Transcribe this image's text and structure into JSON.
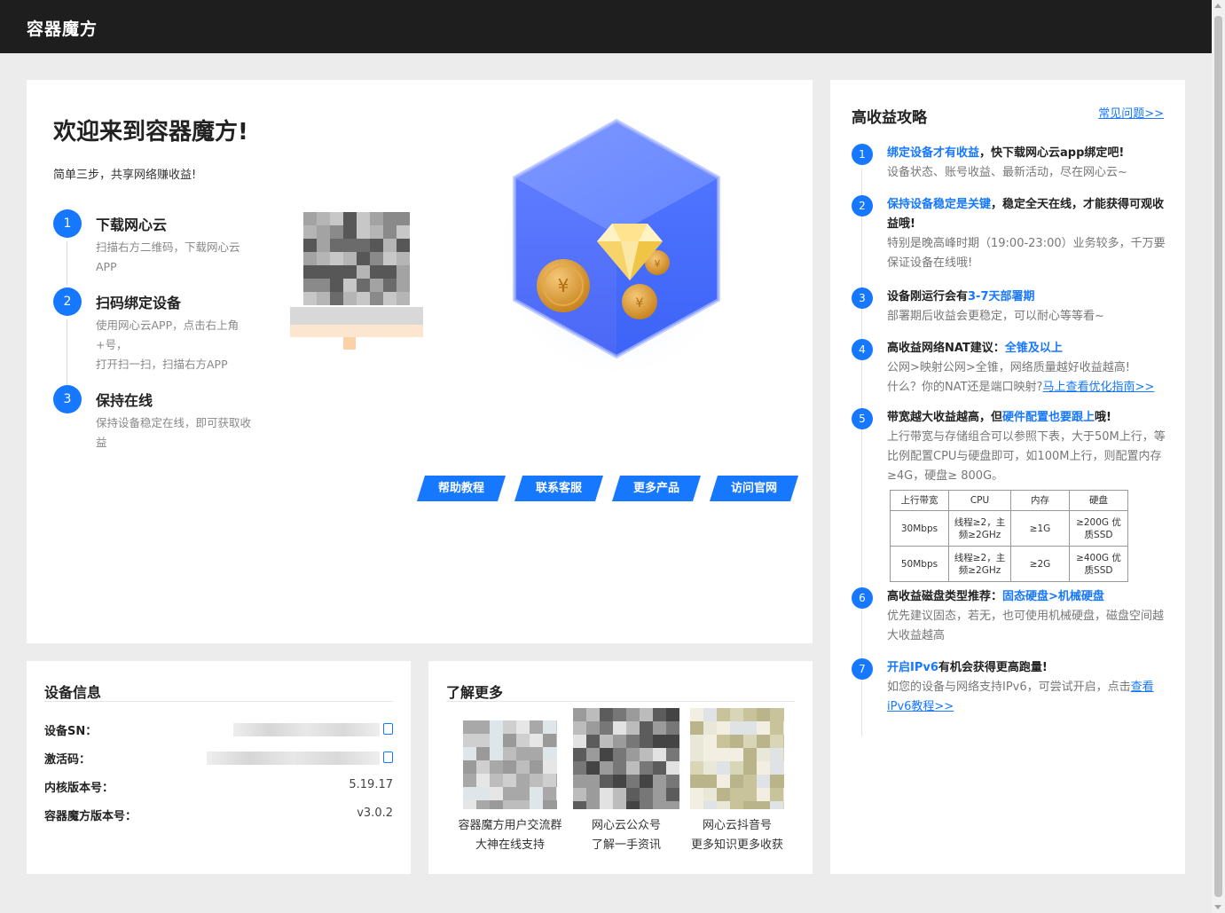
{
  "app": {
    "title": "容器魔方"
  },
  "welcome": {
    "heading": "欢迎来到容器魔方!",
    "subtitle": "简单三步，共享网络赚收益!",
    "steps": [
      {
        "num": "1",
        "title": "下载网心云",
        "desc": "扫描右方二维码，下载网心云APP"
      },
      {
        "num": "2",
        "title": "扫码绑定设备",
        "desc": "使用网心云APP，点击右上角+号，",
        "desc2": "打开扫一扫，扫描右方APP"
      },
      {
        "num": "3",
        "title": "保持在线",
        "desc": "保持设备稳定在线，即可获取收益"
      }
    ],
    "buttons": [
      "帮助教程",
      "联系客服",
      "更多产品",
      "访问官网"
    ]
  },
  "device": {
    "title": "设备信息",
    "rows": [
      {
        "label": "设备SN：",
        "value": ""
      },
      {
        "label": "激活码：",
        "value": ""
      },
      {
        "label": "内核版本号：",
        "value": "5.19.17"
      },
      {
        "label": "容器魔方版本号：",
        "value": "v3.0.2"
      }
    ]
  },
  "more": {
    "title": "了解更多",
    "items": [
      {
        "line1": "容器魔方用户交流群",
        "line2": "大神在线支持"
      },
      {
        "line1": "网心云公众号",
        "line2": "了解一手资讯"
      },
      {
        "line1": "网心云抖音号",
        "line2": "更多知识更多收获"
      }
    ]
  },
  "tips": {
    "title": "高收益攻略",
    "faq_link": "常见问题>>",
    "items": [
      {
        "num": "1",
        "hl": "绑定设备才有收益",
        "h": "，快下载网心云app绑定吧!",
        "d": "设备状态、账号收益、最新活动，尽在网心云~"
      },
      {
        "num": "2",
        "hl": "保持设备稳定是关键",
        "h": "，稳定全天在线，才能获得可观收益哦!",
        "d": "特别是晚高峰时期（19:00-23:00）业务较多，千万要保证设备在线哦!"
      },
      {
        "num": "3",
        "h": "设备刚运行会有",
        "hl": "3-7天部署期",
        "d": "部署期后收益会更稳定，可以耐心等等看~"
      },
      {
        "num": "4",
        "h": "高收益网络NAT建议：",
        "hl": "全锥及以上",
        "d": "公网>映射公网>全锥，网络质量越好收益越高!",
        "d2": "什么？你的NAT还是端口映射?",
        "link": "马上查看优化指南>>"
      },
      {
        "num": "5",
        "h": "带宽越大收益越高，但",
        "hl": "硬件配置也要跟上",
        "h2": "哦!",
        "d": "上行带宽与存储组合可以参照下表，大于50M上行，等比例配置CPU与硬盘即可，如100M上行，则配置内存≥4G，硬盘≥ 800G。"
      },
      {
        "num": "6",
        "h": "高收益磁盘类型推荐：",
        "hl": "固态硬盘>机械硬盘",
        "d": "优先建议固态，若无，也可使用机械硬盘，磁盘空间越大收益越高"
      },
      {
        "num": "7",
        "hl": "开启IPv6",
        "h": "有机会获得更高跑量!",
        "d": "如您的设备与网络支持IPv6，可尝试开启，点击",
        "link": "查看iPv6教程>>"
      }
    ],
    "spec_table": {
      "headers": [
        "上行带宽",
        "CPU",
        "内存",
        "硬盘"
      ],
      "rows": [
        [
          "30Mbps",
          "线程≥2，主频≥2GHz",
          "≥1G",
          "≥200G 优质SSD"
        ],
        [
          "50Mbps",
          "线程≥2，主频≥2GHz",
          "≥2G",
          "≥400G 优质SSD"
        ]
      ]
    }
  },
  "colors": {
    "accent": "#1677ff",
    "topbar": "#1e1e1e",
    "page_bg": "#ececec"
  }
}
